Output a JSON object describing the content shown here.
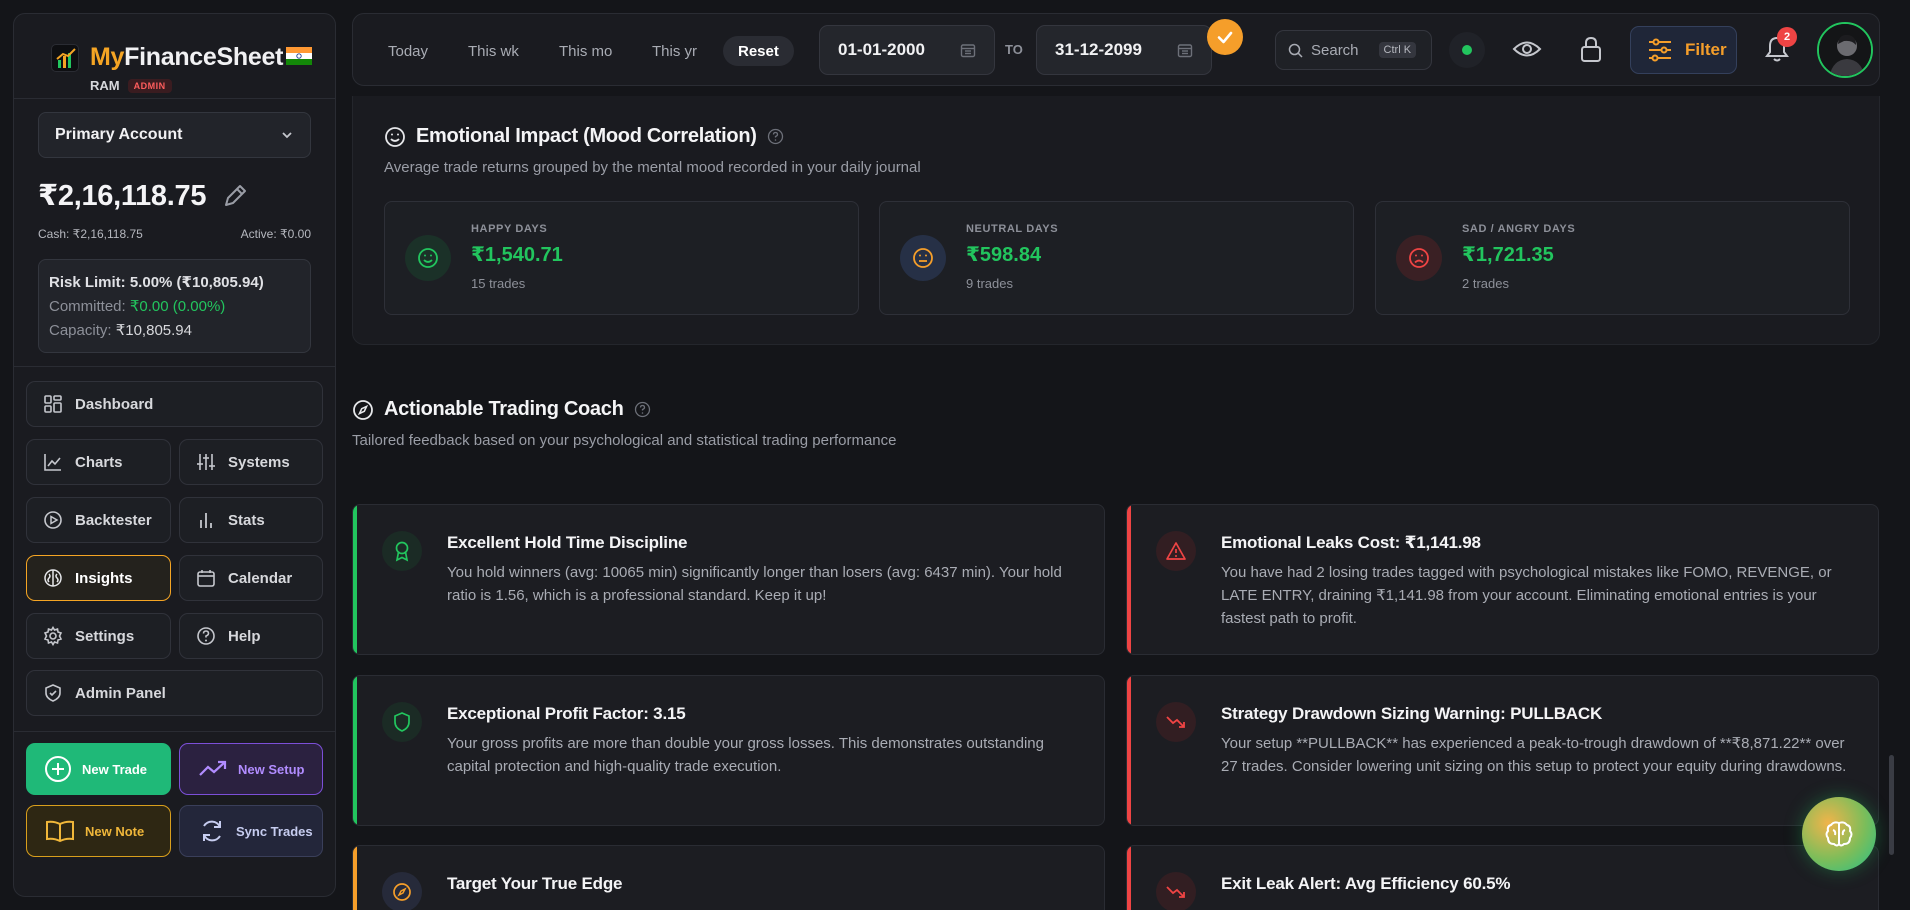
{
  "brand": {
    "my": "My",
    "rest": "FinanceSheet",
    "user": "RAM",
    "role": "ADMIN"
  },
  "account": {
    "selected": "Primary Account",
    "balance": "₹2,16,118.75",
    "cash": "Cash: ₹2,16,118.75",
    "active": "Active: ₹0.00",
    "risk_limit": "Risk Limit: 5.00% (₹10,805.94)",
    "committed_label": "Committed:",
    "committed_value": "₹0.00 (0.00%)",
    "capacity_label": "Capacity:",
    "capacity_value": "₹10,805.94"
  },
  "nav": {
    "dashboard": "Dashboard",
    "charts": "Charts",
    "systems": "Systems",
    "backtester": "Backtester",
    "stats": "Stats",
    "insights": "Insights",
    "calendar": "Calendar",
    "settings": "Settings",
    "help": "Help",
    "admin": "Admin Panel"
  },
  "actions": {
    "new_trade": "New Trade",
    "new_setup": "New Setup",
    "new_note": "New Note",
    "sync_trades": "Sync Trades"
  },
  "topbar": {
    "today": "Today",
    "week": "This wk",
    "month": "This mo",
    "year": "This yr",
    "reset": "Reset",
    "date_from": "01-01-2000",
    "to_label": "TO",
    "date_to": "31-12-2099",
    "search_label": "Search",
    "search_shortcut": "Ctrl K",
    "filter": "Filter",
    "notifications": "2"
  },
  "mood": {
    "title": "Emotional Impact (Mood Correlation)",
    "subtitle": "Average trade returns grouped by the mental mood recorded in your daily journal",
    "cards": [
      {
        "label": "HAPPY DAYS",
        "value": "₹1,540.71",
        "count": "15 trades"
      },
      {
        "label": "NEUTRAL DAYS",
        "value": "₹598.84",
        "count": "9 trades"
      },
      {
        "label": "SAD / ANGRY DAYS",
        "value": "₹1,721.35",
        "count": "2 trades"
      }
    ]
  },
  "coach": {
    "title": "Actionable Trading Coach",
    "subtitle": "Tailored feedback based on your psychological and statistical trading performance",
    "cards": [
      {
        "title": "Excellent Hold Time Discipline",
        "body": "You hold winners (avg: 10065 min) significantly longer than losers (avg: 6437 min). Your hold ratio is 1.56, which is a professional standard. Keep it up!"
      },
      {
        "title": "Emotional Leaks Cost: ₹1,141.98",
        "body": "You have had 2 losing trades tagged with psychological mistakes like FOMO, REVENGE, or LATE ENTRY, draining ₹1,141.98 from your account. Eliminating emotional entries is your fastest path to profit."
      },
      {
        "title": "Exceptional Profit Factor: 3.15",
        "body": "Your gross profits are more than double your gross losses. This demonstrates outstanding capital protection and high-quality trade execution."
      },
      {
        "title": "Strategy Drawdown Sizing Warning: PULLBACK",
        "body": "Your setup **PULLBACK** has experienced a peak-to-trough drawdown of **₹8,871.22** over 27 trades. Consider lowering unit sizing on this setup to protect your equity during drawdowns."
      },
      {
        "title": "Target Your True Edge",
        "body": ""
      },
      {
        "title": "Exit Leak Alert: Avg Efficiency 60.5%",
        "body": ""
      }
    ]
  },
  "colors": {
    "accent": "#f5a524",
    "positive": "#22c55e",
    "negative": "#ef4444",
    "warning": "#f59e2a"
  }
}
